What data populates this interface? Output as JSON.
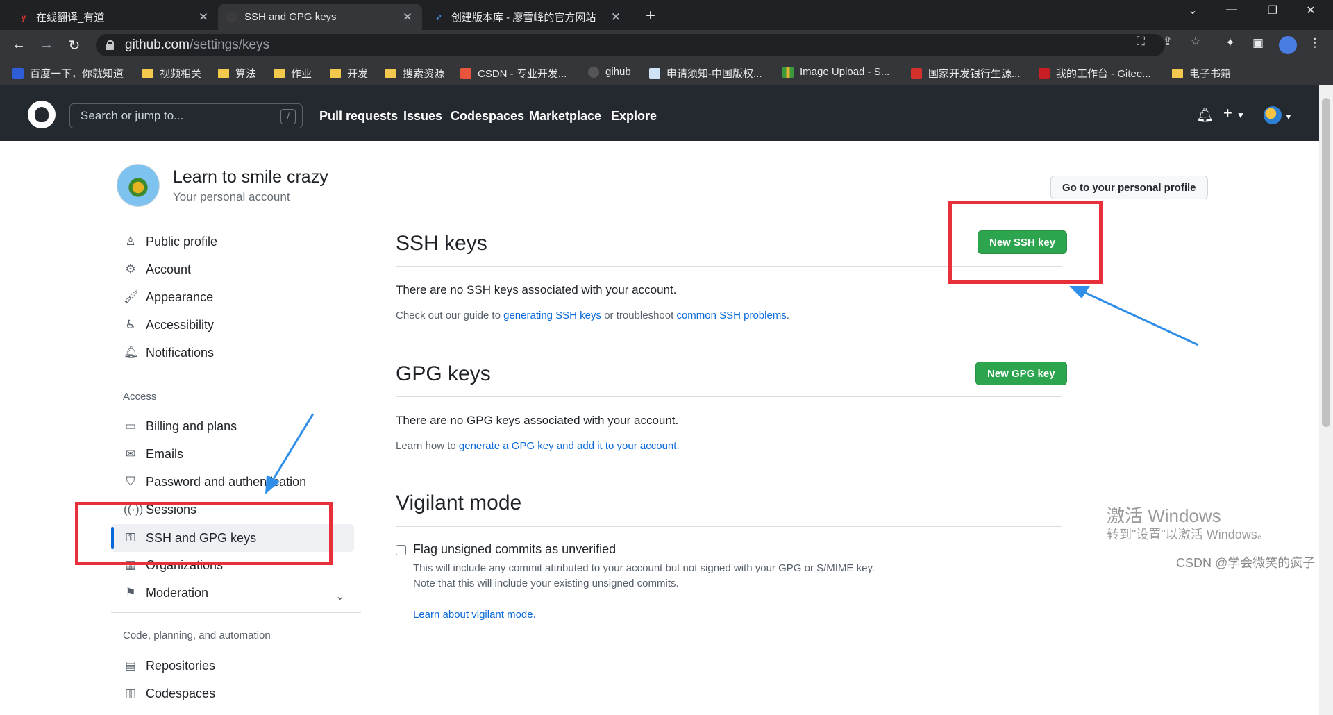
{
  "browser": {
    "tabs": [
      {
        "title": "在线翻译_有道",
        "favicon": "youdao-icon",
        "active": false
      },
      {
        "title": "SSH and GPG keys",
        "favicon": "github-icon",
        "active": true
      },
      {
        "title": "创建版本库 - 廖雪峰的官方网站",
        "favicon": "rocket-icon",
        "active": false
      }
    ],
    "new_tab_symbol": "+",
    "url_host": "github.com",
    "url_path": "/settings/keys",
    "bookmarks": [
      {
        "label": "百度一下，你就知道",
        "icon": "baidu-icon"
      },
      {
        "label": "视频相关",
        "icon": "folder-icon"
      },
      {
        "label": "算法",
        "icon": "folder-icon"
      },
      {
        "label": "作业",
        "icon": "folder-icon"
      },
      {
        "label": "开发",
        "icon": "folder-icon"
      },
      {
        "label": "搜索资源",
        "icon": "folder-icon"
      },
      {
        "label": "CSDN - 专业开发...",
        "icon": "csdn-icon"
      },
      {
        "label": "gihub",
        "icon": "github-icon"
      },
      {
        "label": "申请须知-中国版权...",
        "icon": "copyright-icon"
      },
      {
        "label": "Image Upload - S...",
        "icon": "chart-icon"
      },
      {
        "label": "国家开发银行生源...",
        "icon": "bank-icon"
      },
      {
        "label": "我的工作台 - Gitee...",
        "icon": "gitee-icon"
      },
      {
        "label": "电子书籍",
        "icon": "folder-icon"
      }
    ]
  },
  "github": {
    "search_placeholder": "Search or jump to...",
    "search_shortcut": "/",
    "nav": [
      "Pull requests",
      "Issues",
      "Codespaces",
      "Marketplace",
      "Explore"
    ],
    "plus_symbol": "+"
  },
  "account": {
    "name": "Learn to smile crazy",
    "subtitle": "Your personal account",
    "profile_button": "Go to your personal profile"
  },
  "sidebar": {
    "group1": [
      {
        "label": "Public profile",
        "icon": "person-icon"
      },
      {
        "label": "Account",
        "icon": "gear-icon"
      },
      {
        "label": "Appearance",
        "icon": "paintbrush-icon"
      },
      {
        "label": "Accessibility",
        "icon": "accessibility-icon"
      },
      {
        "label": "Notifications",
        "icon": "bell-icon"
      }
    ],
    "access_heading": "Access",
    "group2": [
      {
        "label": "Billing and plans",
        "icon": "credit-card-icon"
      },
      {
        "label": "Emails",
        "icon": "mail-icon"
      },
      {
        "label": "Password and authentication",
        "icon": "shield-icon"
      },
      {
        "label": "Sessions",
        "icon": "broadcast-icon"
      },
      {
        "label": "SSH and GPG keys",
        "icon": "key-icon",
        "selected": true
      },
      {
        "label": "Organizations",
        "icon": "organization-icon"
      },
      {
        "label": "Moderation",
        "icon": "report-icon"
      }
    ],
    "code_heading": "Code, planning, and automation",
    "group3": [
      {
        "label": "Repositories",
        "icon": "repo-icon"
      },
      {
        "label": "Codespaces",
        "icon": "codespaces-icon"
      }
    ]
  },
  "ssh": {
    "title": "SSH keys",
    "button": "New SSH key",
    "empty": "There are no SSH keys associated with your account.",
    "note_prefix": "Check out our guide to ",
    "note_link1": "generating SSH keys",
    "note_mid": " or troubleshoot ",
    "note_link2": "common SSH problems",
    "note_suffix": "."
  },
  "gpg": {
    "title": "GPG keys",
    "button": "New GPG key",
    "empty": "There are no GPG keys associated with your account.",
    "note_prefix": "Learn how to ",
    "note_link": "generate a GPG key and add it to your account",
    "note_suffix": "."
  },
  "vigilant": {
    "title": "Vigilant mode",
    "checkbox_label": "Flag unsigned commits as unverified",
    "checked": false,
    "desc1": "This will include any commit attributed to your account but not signed with your GPG or S/MIME key.",
    "desc2": "Note that this will include your existing unsigned commits.",
    "link": "Learn about vigilant mode."
  },
  "overlay": {
    "watermark_title": "激活 Windows",
    "watermark_sub": "转到\"设置\"以激活 Windows。",
    "csdn": "CSDN @学会微笑的疯子"
  },
  "colors": {
    "accent": "#0969da",
    "green": "#2da44e",
    "annotation_red": "#e7303a",
    "annotation_blue": "#2f8fe8"
  }
}
